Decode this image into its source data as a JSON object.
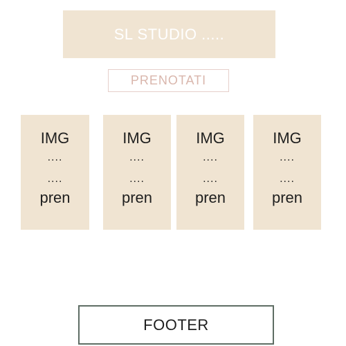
{
  "header": {
    "title": "SL STUDIO ....."
  },
  "book_button": {
    "label": "PRENOTATI"
  },
  "cards": [
    {
      "image_label": "IMG",
      "line1": "....",
      "line2": "....",
      "action_label": "pren"
    },
    {
      "image_label": "IMG",
      "line1": "....",
      "line2": "....",
      "action_label": "pren"
    },
    {
      "image_label": "IMG",
      "line1": "....",
      "line2": "....",
      "action_label": "pren"
    },
    {
      "image_label": "IMG",
      "line1": "....",
      "line2": "....",
      "action_label": "pren"
    }
  ],
  "footer": {
    "label": "FOOTER"
  },
  "colors": {
    "beige": "#f0e4d2",
    "button_border": "#e6cfca",
    "button_text": "#d9b6ac",
    "footer_border": "#5e6d64"
  }
}
